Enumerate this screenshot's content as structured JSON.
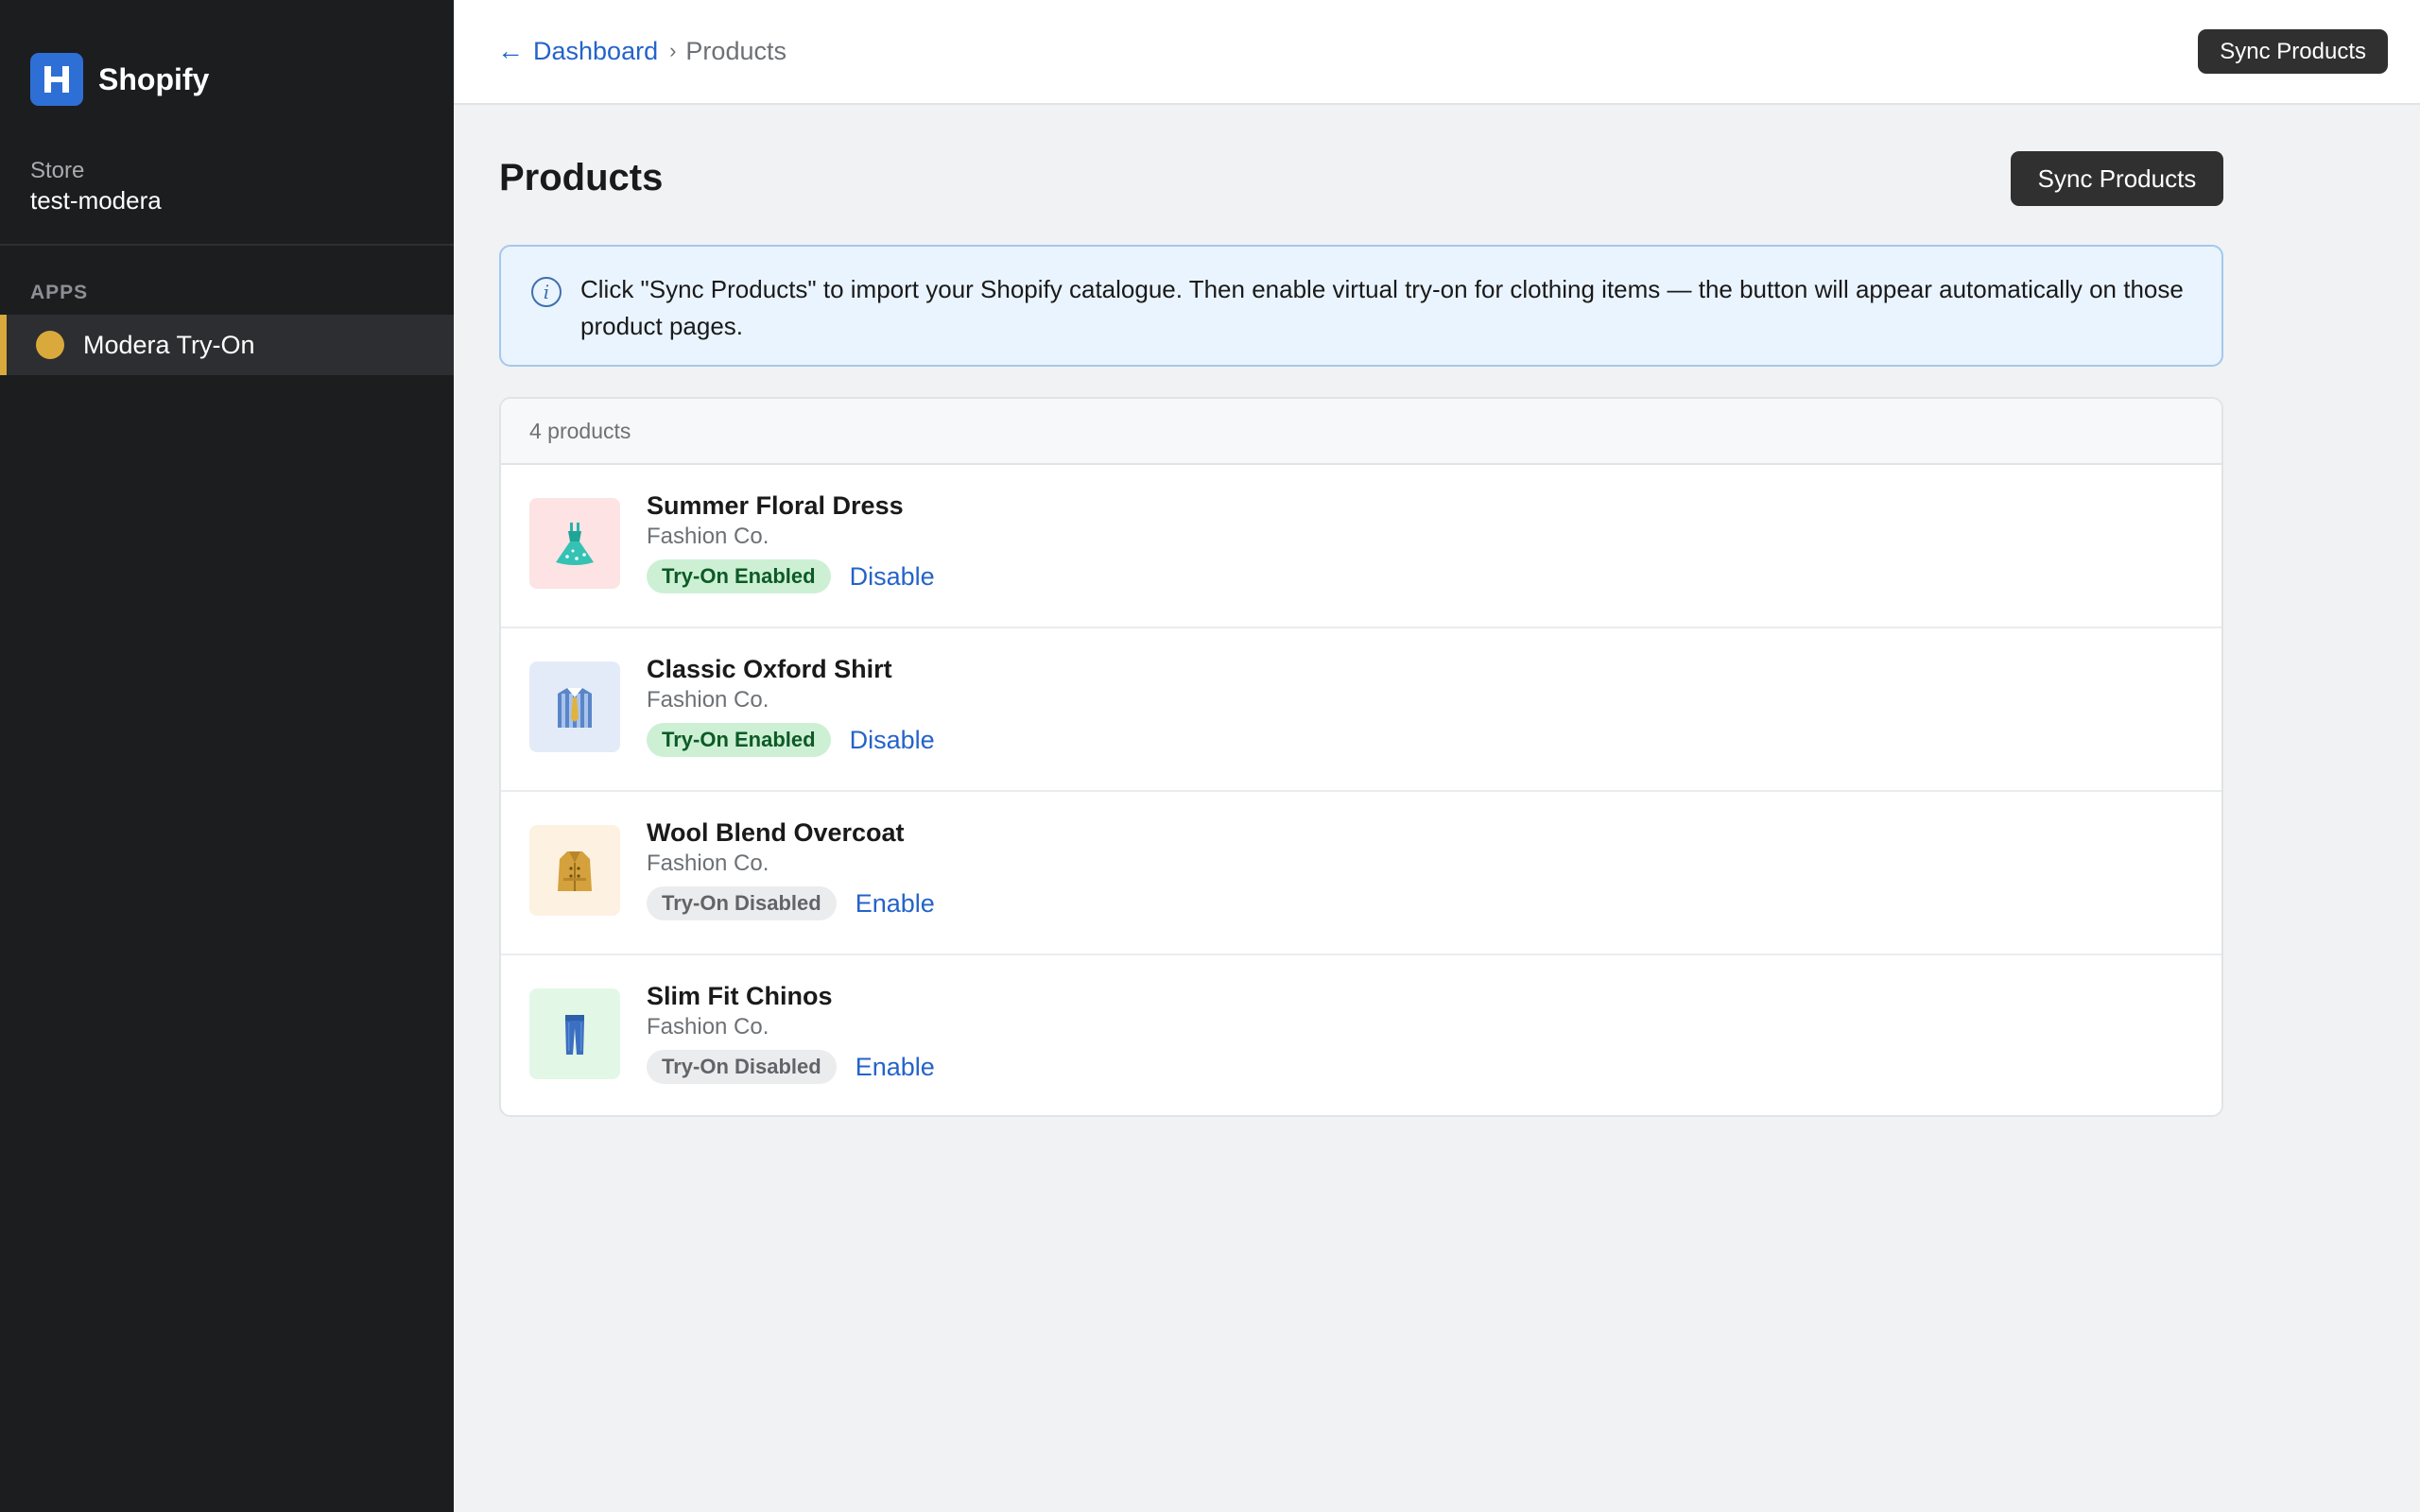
{
  "sidebar": {
    "brand_name": "Shopify",
    "logo_letter": "H",
    "store_label": "Store",
    "store_name": "test-modera",
    "section_label": "APPS",
    "nav_item": "Modera Try-On",
    "accent_color": "#d9a93b"
  },
  "topbar": {
    "back_link": "Dashboard",
    "back_arrow": "←",
    "separator": "›",
    "current": "Products",
    "sync_button": "Sync Products"
  },
  "main": {
    "title": "Products",
    "sync_button": "Sync Products",
    "info_banner": {
      "icon": "info-icon",
      "text": "Click \"Sync Products\" to import your Shopify catalogue. Then enable virtual try-on for clothing items — the button will appear automatically on those product pages."
    },
    "product_count": "4 products",
    "products": [
      {
        "name": "Summer Floral Dress",
        "vendor": "Fashion Co.",
        "icon": "dress-icon",
        "status": "Try-On Enabled",
        "enabled": true,
        "action": "Disable"
      },
      {
        "name": "Classic Oxford Shirt",
        "vendor": "Fashion Co.",
        "icon": "shirt-icon",
        "status": "Try-On Enabled",
        "enabled": true,
        "action": "Disable"
      },
      {
        "name": "Wool Blend Overcoat",
        "vendor": "Fashion Co.",
        "icon": "coat-icon",
        "status": "Try-On Disabled",
        "enabled": false,
        "action": "Enable"
      },
      {
        "name": "Slim Fit Chinos",
        "vendor": "Fashion Co.",
        "icon": "jeans-icon",
        "status": "Try-On Disabled",
        "enabled": false,
        "action": "Enable"
      }
    ]
  }
}
